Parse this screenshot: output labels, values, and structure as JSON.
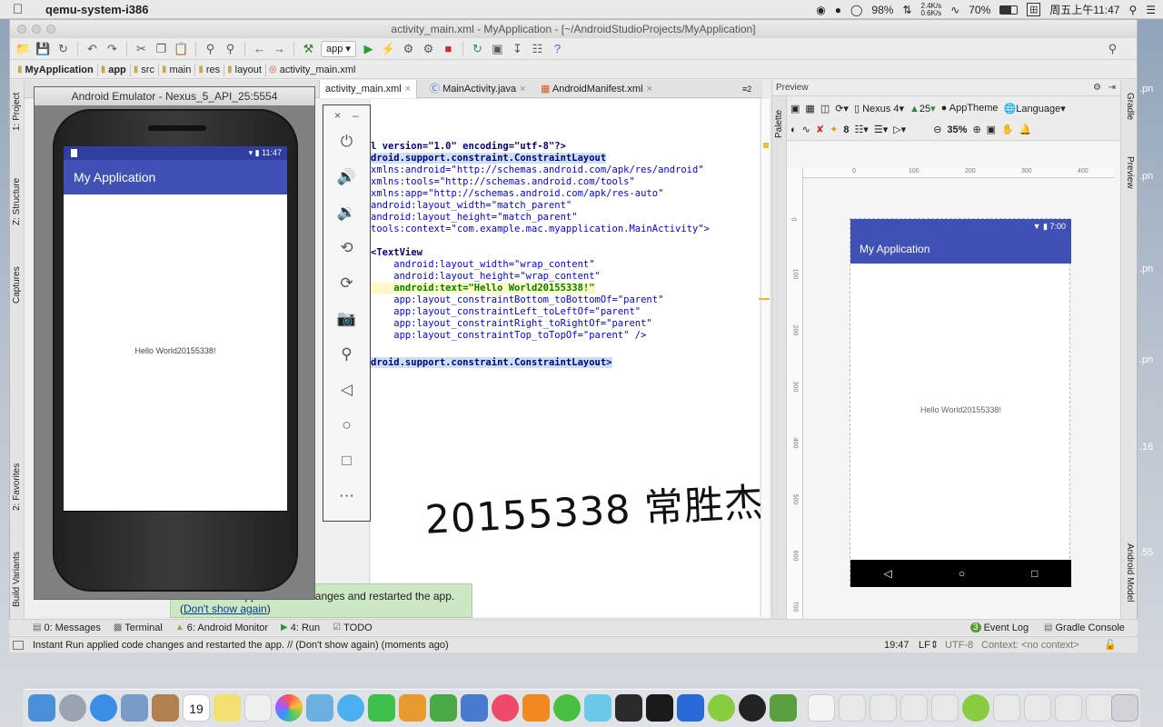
{
  "menubar": {
    "app_name": "qemu-system-i386",
    "battery": "98%",
    "net_up": "2.4K/s",
    "net_down": "0.6K/s",
    "wifi_strength": "70%",
    "clock": "周五上午11:47"
  },
  "ide": {
    "window_title": "activity_main.xml - MyApplication - [~/AndroidStudioProjects/MyApplication]",
    "run_config": "app",
    "breadcrumbs": [
      "MyApplication",
      "app",
      "src",
      "main",
      "res",
      "layout",
      "activity_main.xml"
    ],
    "left_tools": [
      "1: Project",
      "Z: Structure",
      "Captures",
      "2: Favorites",
      "Build Variants"
    ],
    "right_tools": [
      "Gradle",
      "Preview",
      "Android Model"
    ],
    "editor_tabs": [
      {
        "label": "activity_main.xml"
      },
      {
        "label": "MainActivity.java"
      },
      {
        "label": "AndroidManifest.xml"
      }
    ],
    "tab_overflow": "2",
    "code_lines": [
      "l version=\"1.0\" encoding=\"utf-8\"?>",
      "droid.support.constraint.ConstraintLayout",
      "xmlns:android=\"http://schemas.android.com/apk/res/android\"",
      "xmlns:tools=\"http://schemas.android.com/tools\"",
      "xmlns:app=\"http://schemas.android.com/apk/res-auto\"",
      "android:layout_width=\"match_parent\"",
      "android:layout_height=\"match_parent\"",
      "tools:context=\"com.example.mac.myapplication.MainActivity\">",
      "",
      "<TextView",
      "    android:layout_width=\"wrap_content\"",
      "    android:layout_height=\"wrap_content\"",
      "    android:text=\"Hello World20155338!\"",
      "    app:layout_constraintBottom_toBottomOf=\"parent\"",
      "    app:layout_constraintLeft_toLeftOf=\"parent\"",
      "    app:layout_constraintRight_toRightOf=\"parent\"",
      "    app:layout_constraintTop_toTopOf=\"parent\" />",
      "",
      "droid.support.constraint.ConstraintLayout>"
    ],
    "handwritten_note": "20155338 常胜杰",
    "preview": {
      "header": "Preview",
      "device": "Nexus 4",
      "api": "25",
      "theme": "AppTheme",
      "language": "Language",
      "zoom": "35%",
      "font_num": "8",
      "ruler_x": [
        "0",
        "100",
        "200",
        "300",
        "400"
      ],
      "ruler_y": [
        "0",
        "100",
        "200",
        "300",
        "400",
        "500",
        "600",
        "700"
      ],
      "status_time": "7:00",
      "app_title": "My Application",
      "hello_text": "Hello World20155338!"
    },
    "toast": {
      "message": "Instant Run applied code changes and restarted the app.",
      "link": "Don't show again"
    },
    "bottom_tools": {
      "messages": "0: Messages",
      "terminal": "Terminal",
      "monitor": "6: Android Monitor",
      "run": "4: Run",
      "todo": "TODO",
      "event_log": "Event Log",
      "event_count": "3",
      "gradle_console": "Gradle Console"
    },
    "status": {
      "message": "Instant Run applied code changes and restarted the app. // (Don't show again) (moments ago)",
      "position": "19:47",
      "line_sep": "LF",
      "encoding": "UTF-8",
      "context": "Context: <no context>"
    }
  },
  "emulator": {
    "title": "Android Emulator - Nexus_5_API_25:5554",
    "time": "11:47",
    "app_title": "My Application",
    "hello_text": "Hello World20155338!"
  },
  "desktop_right_labels": [
    ".pn",
    ".pn",
    ".pn",
    ".pn",
    ".16",
    ".55"
  ],
  "dock": {
    "calendar_day": "19"
  }
}
